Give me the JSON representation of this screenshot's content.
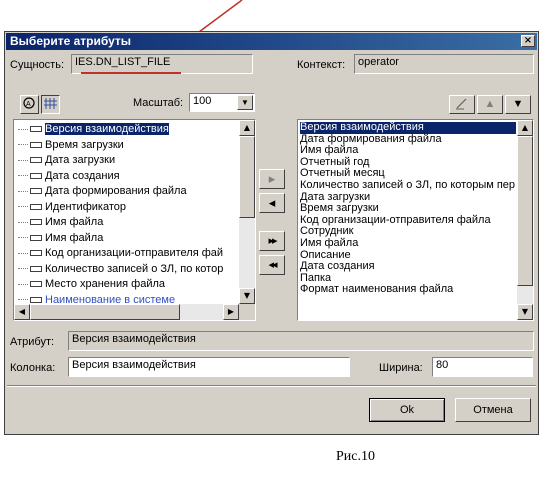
{
  "dialog": {
    "title": "Выберите атрибуты",
    "close_label": "×"
  },
  "entity": {
    "label": "Сущность:",
    "value": "IES.DN_LIST_FILE"
  },
  "context": {
    "label": "Контекст:",
    "value": "operator"
  },
  "scale": {
    "label": "Масштаб:",
    "value": "100"
  },
  "left_list": {
    "items": [
      "Версия взаимодействия",
      "Время загрузки",
      "Дата загрузки",
      "Дата создания",
      "Дата формирования файла",
      "Идентификатор",
      "Имя файла",
      "Имя файла",
      "Код организации-отправителя фай",
      "Количество записей о ЗЛ, по котор",
      "Место хранения файла",
      "Наименование в системе"
    ],
    "selected_index": 0
  },
  "right_list": {
    "items": [
      "Версия взаимодействия",
      "Дата формирования файла",
      "Имя файла",
      "Отчетный год",
      "Отчетный месяц",
      "Количество записей о ЗЛ, по которым пер",
      "Дата загрузки",
      "Время загрузки",
      "Код организации-отправителя файла",
      "Сотрудник",
      "Имя файла",
      "Описание",
      "Дата создания",
      "Папка",
      "Формат наименования файла"
    ],
    "selected_index": 0
  },
  "move_buttons": {
    "add": "▸",
    "remove": "◂",
    "add_all": "▸▸",
    "remove_all": "◂◂"
  },
  "attribute": {
    "label": "Атрибут:",
    "value": "Версия взаимодействия"
  },
  "column": {
    "label": "Колонка:",
    "value": "Версия взаимодействия"
  },
  "width": {
    "label": "Ширина:",
    "value": "80"
  },
  "buttons": {
    "ok": "Ok",
    "cancel": "Отмена"
  },
  "caption": "Рис.10",
  "colors": {
    "titlebar": "#0a246a",
    "selection": "#0a246a",
    "annotation": "#c0302a",
    "dialog_bg": "#d4d0c8"
  }
}
